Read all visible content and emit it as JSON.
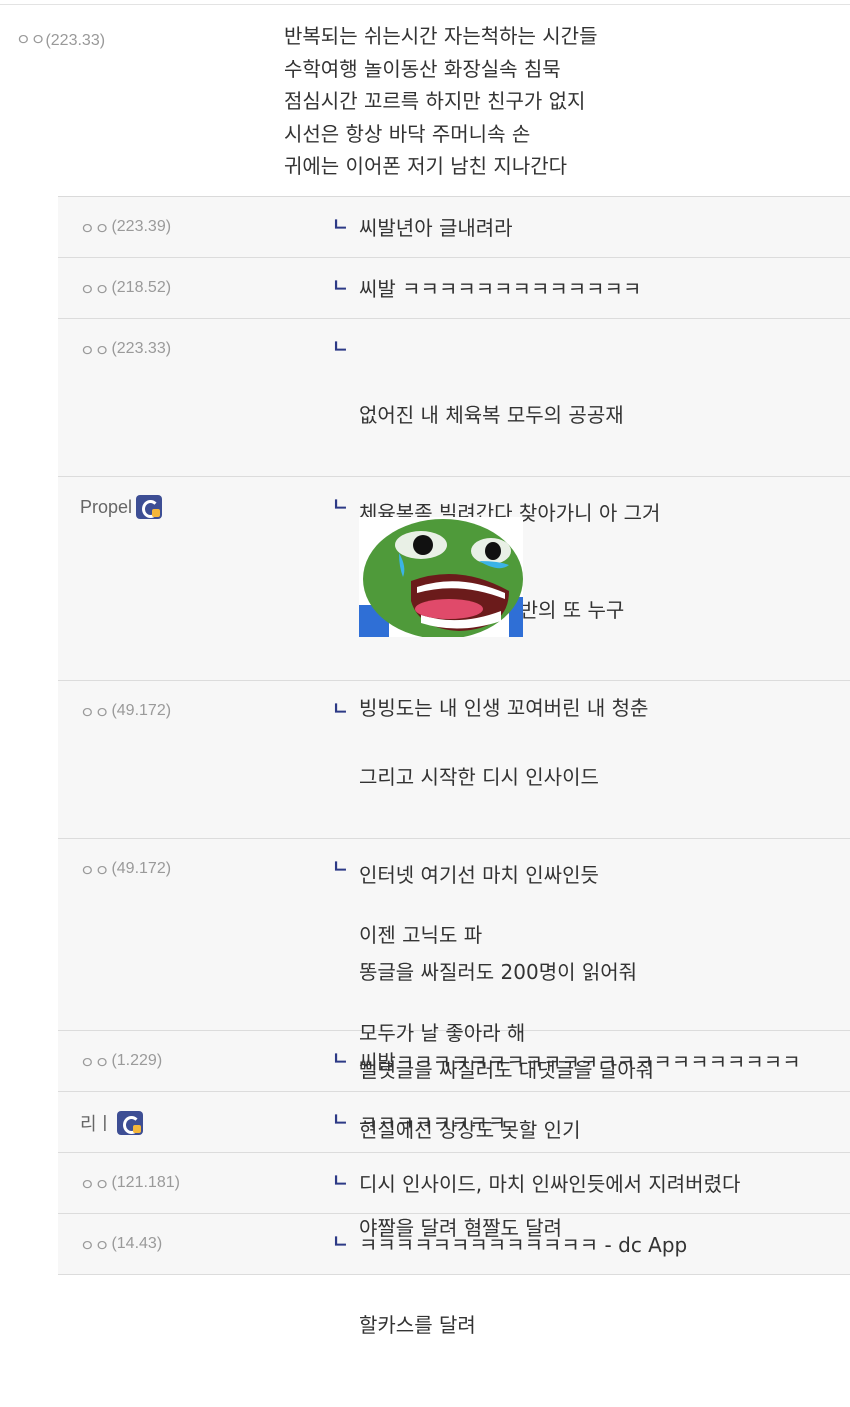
{
  "main_comment": {
    "nick": "ㅇㅇ",
    "ip": "(223.33)",
    "lines": [
      "반복되는 쉬는시간 자는척하는 시간들",
      "수학여행 놀이동산 화장실속 침묵",
      "점심시간 꼬르륵 하지만 친구가 없지",
      "시선은 항상 바닥 주머니속 손",
      "귀에는 이어폰 저기 남친 지나간다"
    ]
  },
  "reply_marker": "ㄴ",
  "replies": [
    {
      "nick": "ㅇㅇ",
      "ip": "(223.39)",
      "lines": [
        "씨발년아 글내려라"
      ]
    },
    {
      "nick": "ㅇㅇ",
      "ip": "(218.52)",
      "lines": [
        "씨발 ㅋㅋㅋㅋㅋㅋㅋㅋㅋㅋㅋㅋㅋ"
      ]
    },
    {
      "nick": "ㅇㅇ",
      "ip": "(223.33)",
      "lines": [
        "없어진 내 체육복 모두의 공공재",
        "체육복좀 빌려간다 찾아가니 아 그거",
        "옆 반의 누구 그 옆 반의 또 누구",
        "빙빙도는 내 인생 꼬여버린 내 청춘"
      ]
    },
    {
      "nick": "Propel",
      "ip": "",
      "member": true,
      "image": "crying-pepe-frog-emoticon",
      "lines": []
    },
    {
      "nick": "ㅇㅇ",
      "ip": "(49.172)",
      "lines": [
        "그리고 시작한 디시 인사이드",
        "인터넷 여기선 마치 인싸인듯",
        "똥글을 싸질러도 200명이 읽어줘",
        "뻘댓글을 싸질러도 대댓글을 달아줘"
      ]
    },
    {
      "nick": "ㅇㅇ",
      "ip": "(49.172)",
      "lines": [
        "이젠 고닉도 파",
        "모두가 날 좋아라 해",
        "현실에선 상상도 못할 인기",
        "야짤을 달려 혐짤도 달려",
        "할카스를 달려"
      ]
    },
    {
      "nick": "ㅇㅇ",
      "ip": "(1.229)",
      "lines": [
        "씨발ㅋㅋㅋㅋㅋㅋㅋㅋㅋㅋㅋㅋㅋㅋㅋㅋㅋㅋㅋㅋㅋㅋ"
      ]
    },
    {
      "nick": "리ㅣ",
      "ip": "",
      "member": true,
      "lines": [
        "ㅋㅋㅋㅋㅋㅋㅋㅋ"
      ]
    },
    {
      "nick": "ㅇㅇ",
      "ip": "(121.181)",
      "lines": [
        "디시 인사이드, 마치 인싸인듯에서 지려버렸다"
      ]
    },
    {
      "nick": "ㅇㅇ",
      "ip": "(14.43)",
      "lines": [
        "ㅋㅋㅋㅋㅋㅋㅋㅋㅋㅋㅋㅋㅋ - dc App"
      ]
    }
  ]
}
